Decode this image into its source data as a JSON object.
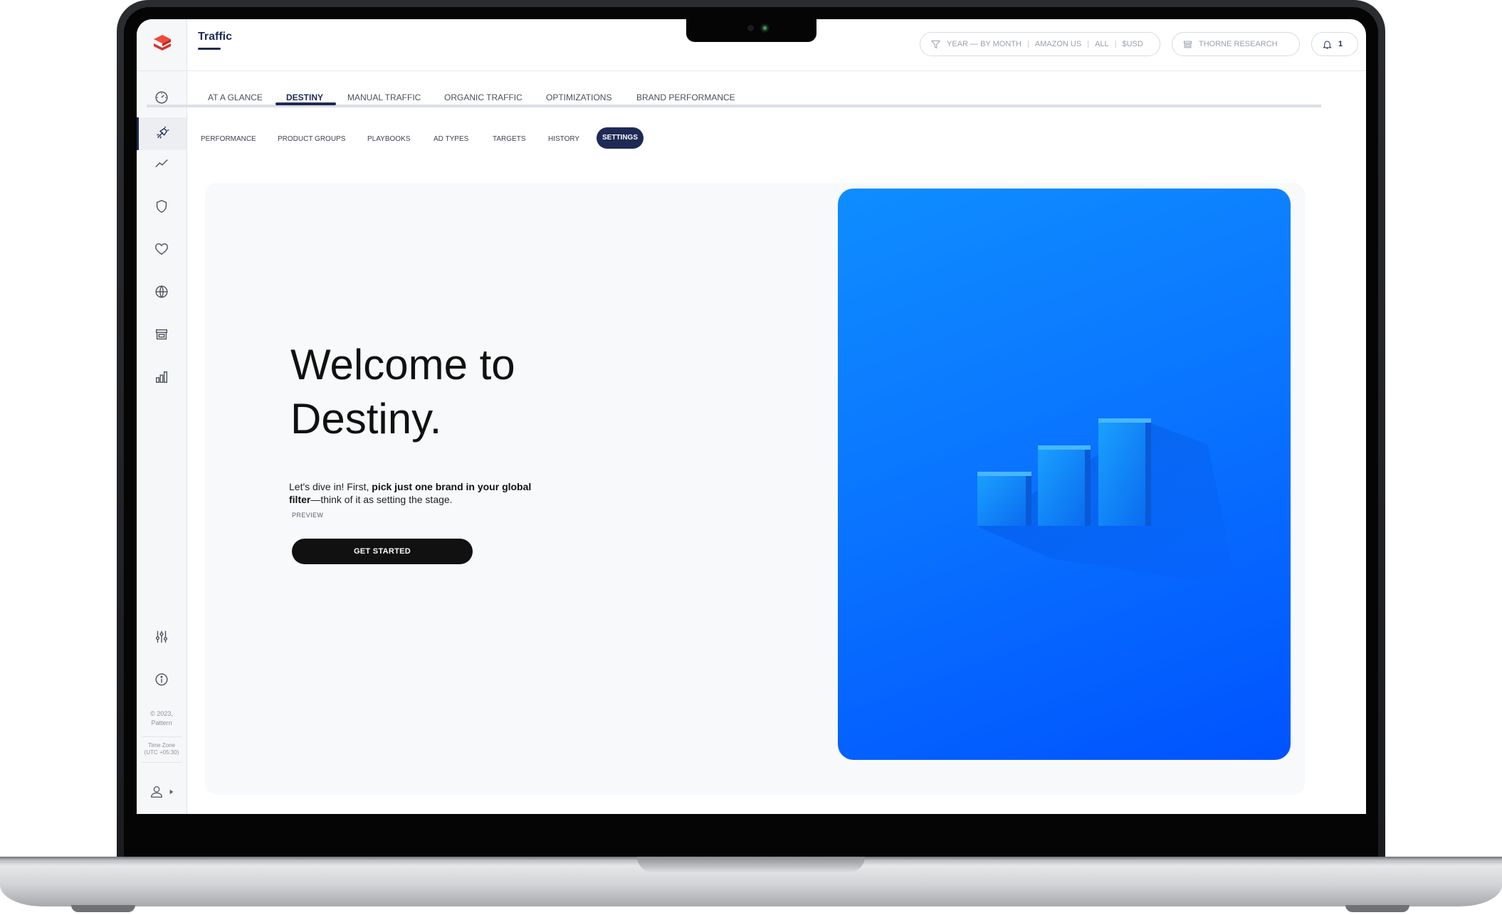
{
  "app": {
    "page_title": "Traffic"
  },
  "global_filter": {
    "parts": [
      "YEAR — BY MONTH",
      "AMAZON US",
      "ALL",
      "$USD"
    ],
    "brand": "THORNE RESEARCH",
    "notifications_count": "1"
  },
  "tabs": [
    {
      "label": "AT A GLANCE"
    },
    {
      "label": "DESTINY",
      "active": true
    },
    {
      "label": "MANUAL TRAFFIC"
    },
    {
      "label": "ORGANIC TRAFFIC"
    },
    {
      "label": "OPTIMIZATIONS"
    },
    {
      "label": "BRAND PERFORMANCE"
    }
  ],
  "subtabs": [
    {
      "label": "PERFORMANCE"
    },
    {
      "label": "PRODUCT GROUPS"
    },
    {
      "label": "PLAYBOOKS"
    },
    {
      "label": "AD TYPES"
    },
    {
      "label": "TARGETS"
    },
    {
      "label": "HISTORY"
    },
    {
      "label": "SETTINGS",
      "active": true
    }
  ],
  "sidebar": {
    "icons": [
      "dashboard-gauge-icon",
      "traffic-rocket-icon",
      "trend-line-icon",
      "shield-icon",
      "heart-icon",
      "globe-icon",
      "store-icon",
      "bar-chart-icon"
    ],
    "bottom_icons": [
      "sliders-icon",
      "info-icon",
      "user-icon"
    ],
    "copyright_line1": "© 2023,",
    "copyright_line2": "Pattern",
    "timezone_label": "Time Zone",
    "timezone_value": "(UTC +05:30)"
  },
  "welcome": {
    "heading_line1": "Welcome to",
    "heading_line2": "Destiny.",
    "desc_prefix": "Let's dive in! First, ",
    "desc_bold": "pick just one brand in your global filter",
    "desc_suffix": "—think of it as setting the stage.",
    "preview_link": "PREVIEW",
    "cta_label": "GET STARTED"
  },
  "colors": {
    "brand_navy": "#1e2a55",
    "logo_red": "#ef4b3a",
    "hero_blue": "#0a75ff",
    "cta_black": "#111111"
  }
}
